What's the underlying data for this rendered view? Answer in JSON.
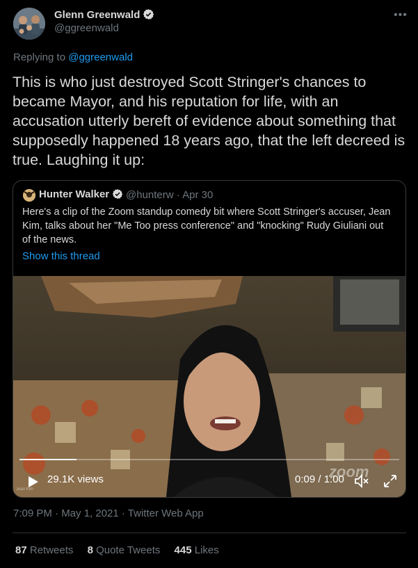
{
  "author": {
    "name": "Glenn Greenwald",
    "handle": "@ggreenwald"
  },
  "reply": {
    "prefix": "Replying to ",
    "mention": "@ggreenwald"
  },
  "tweet": {
    "text": "This is who just destroyed Scott Stringer's chances to became Mayor, and his reputation for life, with an accusation utterly bereft of evidence about something that supposedly happened 18 years ago, that the left decreed is true. Laughing it up:"
  },
  "quote": {
    "name": "Hunter Walker",
    "handle_date": "@hunterw · Apr 30",
    "text": "Here's a clip of the Zoom standup comedy bit where Scott Stringer's accuser, Jean Kim, talks about her \"Me Too press conference\" and \"knocking\" Rudy Giuliani out of the news.",
    "show_thread": "Show this thread",
    "video": {
      "views": "29.1K views",
      "time": "0:09 / 1:00",
      "progress": 0.15,
      "watermark": "zoom",
      "name_tag": "Jean Kim"
    }
  },
  "meta": {
    "timestamp": "7:09 PM · May 1, 2021 · Twitter Web App"
  },
  "stats": {
    "retweets_count": "87",
    "retweets_label": "Retweets",
    "quotes_count": "8",
    "quotes_label": "Quote Tweets",
    "likes_count": "445",
    "likes_label": "Likes"
  },
  "colors": {
    "background": "#000000",
    "text": "#d9d9d9",
    "muted": "#6e767d",
    "link": "#1d9bf0",
    "border": "#2f3336"
  }
}
